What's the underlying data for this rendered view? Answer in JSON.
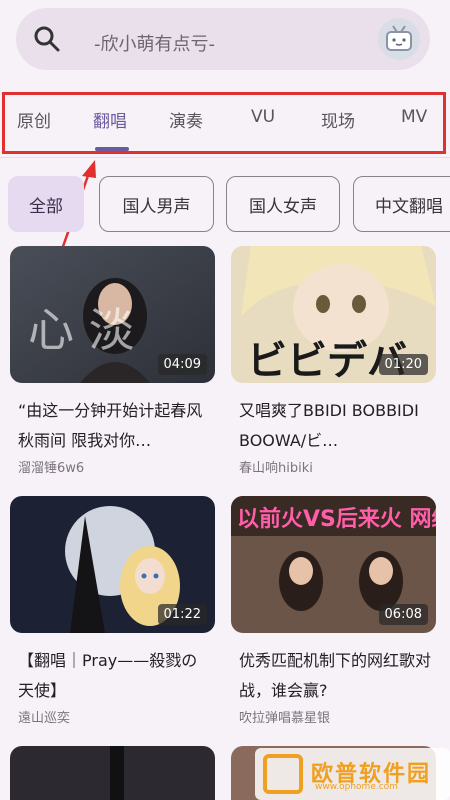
{
  "search": {
    "placeholder": "-欣小萌有点亏-"
  },
  "tabs": [
    {
      "label": "原创"
    },
    {
      "label": "翻唱"
    },
    {
      "label": "演奏"
    },
    {
      "label": "VU"
    },
    {
      "label": "现场"
    },
    {
      "label": "MV"
    }
  ],
  "filters": [
    {
      "label": "全部"
    },
    {
      "label": "国人男声"
    },
    {
      "label": "国人女声"
    },
    {
      "label": "中文翻唱"
    }
  ],
  "videos": [
    {
      "duration": "04:09",
      "title": "“由这一分钟开始计起春风秋雨间 限我对你…",
      "author": "溜溜锤6w6",
      "thumb_text": "心 淡"
    },
    {
      "duration": "01:20",
      "title": "又唱爽了BBIDI BOBBIDI BOOWA/ビ…",
      "author": "春山响hibiki",
      "thumb_text": "ビビデバ"
    },
    {
      "duration": "01:22",
      "title": "【翻唱｜Pray——殺戮の天使】",
      "author": "遠山巡奕",
      "thumb_text": ""
    },
    {
      "duration": "06:08",
      "title": "优秀匹配机制下的网红歌对战，谁会赢?",
      "author": "吹拉弹唱慕星银",
      "thumb_text": "以前火VS后来火 网络歌曲"
    },
    {
      "duration": "",
      "title": "",
      "author": "",
      "thumb_text": ""
    },
    {
      "duration": "",
      "title": "",
      "author": "",
      "thumb_text": ""
    }
  ],
  "watermark": {
    "text": "欧普软件园",
    "sub": "www.ophome.com"
  },
  "colors": {
    "accent": "#6b5a9e",
    "highlight_box": "#e0312e",
    "background": "#f7f1f8"
  }
}
